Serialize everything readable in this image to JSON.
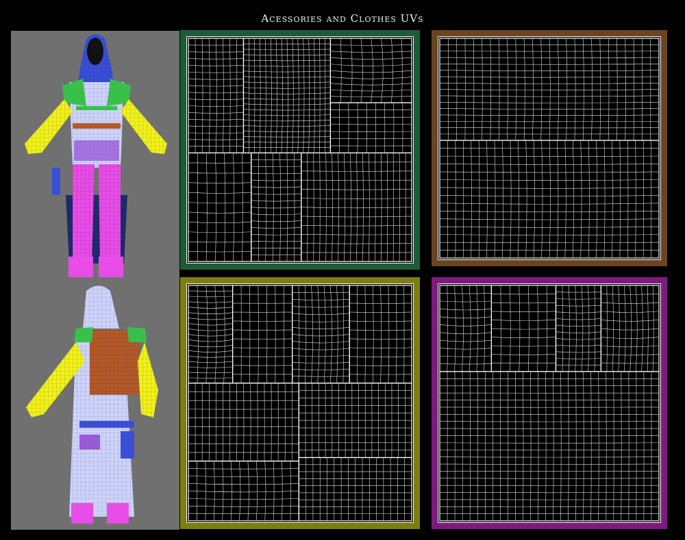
{
  "title": "Acessories and Clothes UVs",
  "colors": {
    "background": "#000000",
    "model_panel": "#707070",
    "uv_frames": [
      "#1c5c36",
      "#6b4520",
      "#7e7e10",
      "#7e1a7e"
    ],
    "wire_yellow": "#f2f21a",
    "wire_magenta": "#e84de8",
    "wire_blue": "#3a4fd6",
    "wire_green": "#39c04a",
    "wire_brown": "#b45a2a",
    "wire_white": "#e8e8ff"
  },
  "models": [
    {
      "name": "character-front-view"
    },
    {
      "name": "character-back-view"
    }
  ],
  "uv_maps": [
    {
      "name": "uv-map-green"
    },
    {
      "name": "uv-map-brown"
    },
    {
      "name": "uv-map-olive"
    },
    {
      "name": "uv-map-purple"
    }
  ]
}
